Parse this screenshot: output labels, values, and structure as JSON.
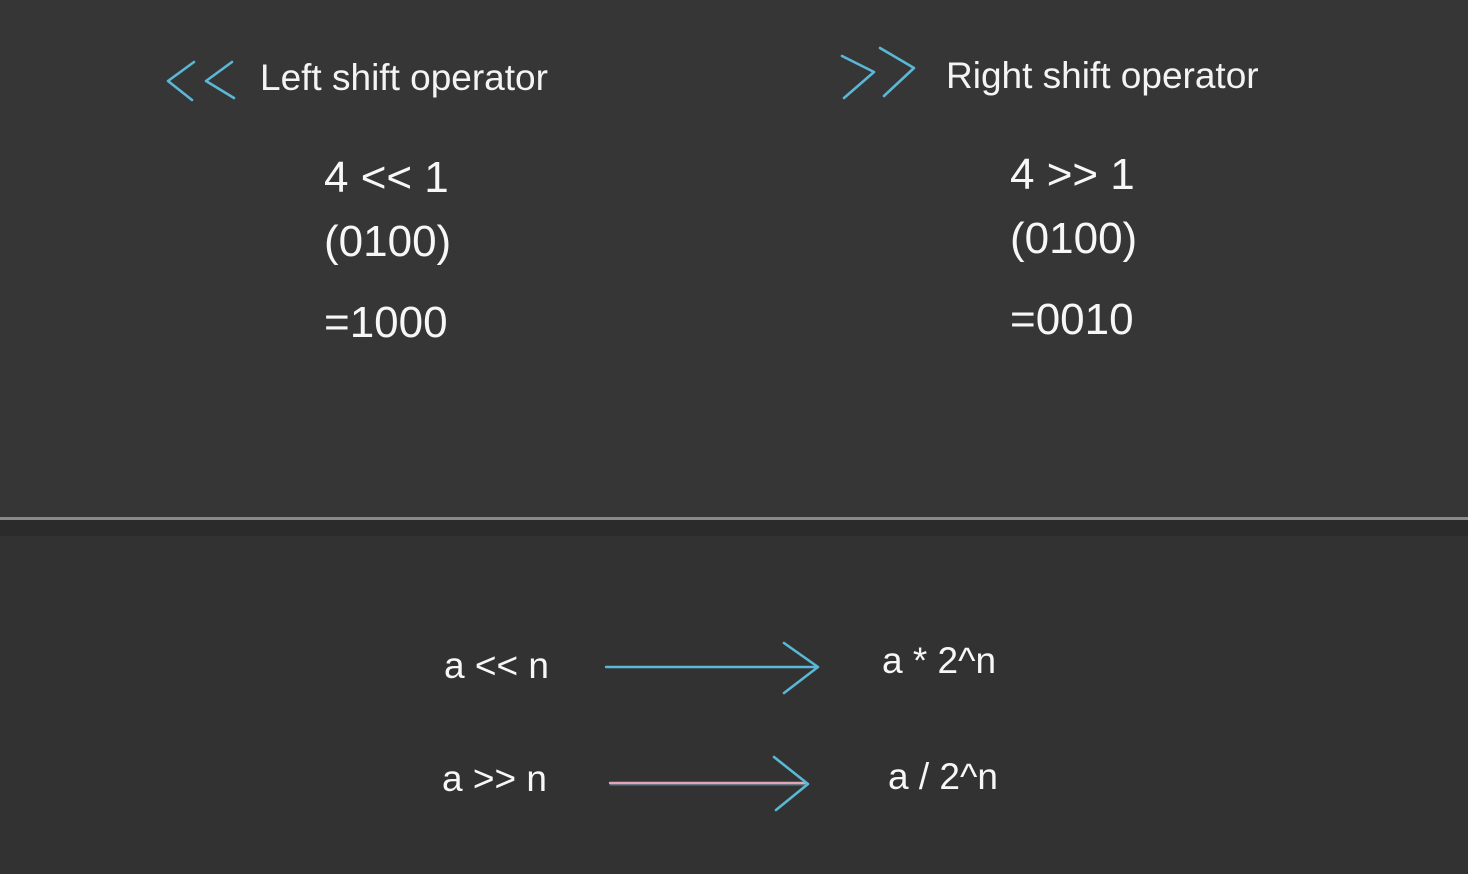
{
  "colors": {
    "background": "#333333",
    "text": "#f7f7f7",
    "accent_blue": "#5ab8d6",
    "accent_pink": "#e0a6b8",
    "divider": "#8a8a8a"
  },
  "left_section": {
    "icon": "double-left-chevron-icon",
    "title": "Left shift operator",
    "expression": "4 << 1",
    "binary_input": "(0100)",
    "result": "=1000"
  },
  "right_section": {
    "icon": "double-right-chevron-icon",
    "title": "Right shift operator",
    "expression": "4 >> 1",
    "binary_input": "(0100)",
    "result": "=0010"
  },
  "rules": [
    {
      "lhs": "a << n",
      "rhs": "a * 2^n",
      "arrow_icon": "right-arrow-icon"
    },
    {
      "lhs": "a >> n",
      "rhs": "a / 2^n",
      "arrow_icon": "right-arrow-icon"
    }
  ]
}
